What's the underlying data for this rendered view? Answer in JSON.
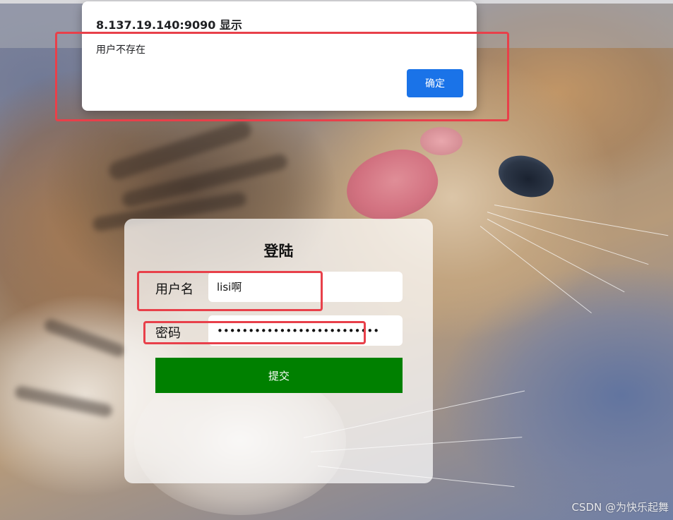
{
  "alert": {
    "title": "8.137.19.140:9090 显示",
    "message": "用户不存在",
    "ok_label": "确定",
    "ok_color": "#1a73e8"
  },
  "login": {
    "title": "登陆",
    "username_label": "用户名",
    "username_value": "lisi啊",
    "password_label": "密码",
    "password_value": "••••••••••••••••••••••••••",
    "submit_label": "提交",
    "submit_color": "#008000"
  },
  "annotations": {
    "color": "#e8404a"
  },
  "watermark": "CSDN @为快乐起舞"
}
